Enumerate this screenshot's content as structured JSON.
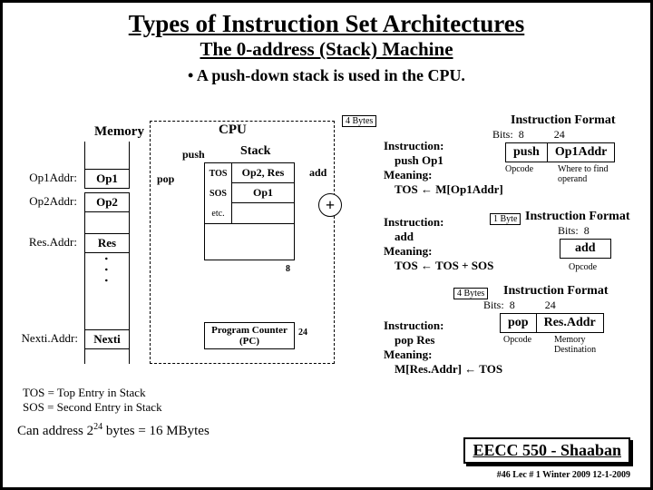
{
  "title": "Types of Instruction Set Architectures",
  "subtitle": "The 0-address (Stack) Machine",
  "bullet": "A push-down stack is used in the CPU.",
  "memory": {
    "header": "Memory",
    "rows": [
      {
        "label": "Op1Addr:",
        "value": "Op1"
      },
      {
        "label": "Op2Addr:",
        "value": "Op2"
      },
      {
        "label": "Res.Addr:",
        "value": "Res"
      },
      {
        "label": "Nexti.Addr:",
        "value": "Nexti"
      }
    ],
    "dots": ". . ."
  },
  "cpu": {
    "label": "CPU",
    "bytes4": "4 Bytes",
    "push_lbl": "push",
    "pop_lbl": "pop",
    "tos": "TOS",
    "sos": "SOS",
    "etc": "etc.",
    "stack_lbl": "Stack",
    "stack_vals": [
      "Op2, Res",
      "Op1"
    ],
    "add_lbl": "add",
    "plus": "+",
    "width8": "8",
    "pc_label": "Program Counter (PC)",
    "pc_bits": "24"
  },
  "fmt1": {
    "title": "Instruction Format",
    "bits_lbl": "Bits:",
    "b1": "8",
    "b2": "24",
    "c1": "push",
    "c2": "Op1Addr",
    "cap1": "Opcode",
    "cap2": "Where to find operand"
  },
  "instr1": {
    "l1": "Instruction:",
    "l2": "push Op1",
    "l3": "Meaning:",
    "l4_a": "TOS",
    "l4_b": "M[Op1Addr]"
  },
  "fmt2": {
    "byte1": "1 Byte",
    "title": "Instruction Format",
    "bits_lbl": "Bits:",
    "b1": "8",
    "c1": "add",
    "cap1": "Opcode"
  },
  "instr2": {
    "l1": "Instruction:",
    "l2": "add",
    "l3": "Meaning:",
    "l4_a": "TOS",
    "l4_b": "TOS + SOS"
  },
  "fmt3": {
    "bytes4": "4 Bytes",
    "title": "Instruction Format",
    "bits_lbl": "Bits:",
    "b1": "8",
    "b2": "24",
    "c1": "pop",
    "c2": "Res.Addr",
    "cap1": "Opcode",
    "cap2": "Memory Destination"
  },
  "instr3": {
    "l1": "Instruction:",
    "l2": "pop Res",
    "l3": "Meaning:",
    "l4_a": "M[Res.Addr]",
    "l4_b": "TOS"
  },
  "notes": {
    "tos": "TOS = Top Entry in Stack",
    "sos": "SOS = Second Entry in Stack",
    "addr": "Can address 2^24 bytes = 16 MBytes",
    "addr_html": "Can address 2<sup>24</sup> bytes = 16 MBytes"
  },
  "footer": {
    "course": "EECC 550 - Shaaban",
    "meta": "#46  Lec # 1 Winter 2009  12-1-2009"
  }
}
